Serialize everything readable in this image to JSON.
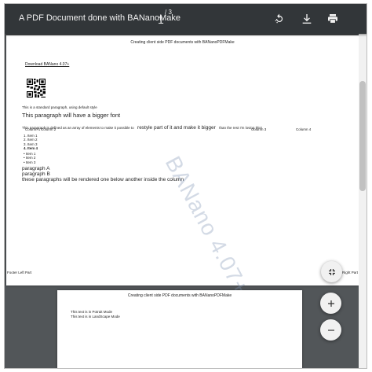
{
  "toolbar": {
    "title": "A PDF Document done with BANanoMake",
    "page_current": "1",
    "page_separator": "/ 3"
  },
  "page1": {
    "header": "Creating client side PDF documents with BANanoPDFMake",
    "link": "Download BANano 4.07+",
    "standard_paragraph": "This is a standard paragraph, using default style",
    "bigger_font": "This paragraph will have a bigger font",
    "array_text_start": "This paragraph is defined as an array of elements to make it possible to",
    "array_text_restyle": "restyle part of it and make it bigger",
    "array_text_end": "than the rest I'm loving this!",
    "columns": [
      "Column 1",
      "Column 2",
      "Column 3",
      "Column 4"
    ],
    "ordered_list": [
      "1. Item 1",
      "2. Item 2",
      "3. Item 3",
      "4. Item 4"
    ],
    "bullet_list": [
      "• Item 1",
      "• Item 2",
      "• Item 3"
    ],
    "paragraph_a": "paragraph A",
    "paragraph_b": "paragraph B",
    "below_text": "these paragraphs will be rendered one below another inside the column",
    "watermark": "BANano 4.07+",
    "footer_left": "Footer Left Part",
    "footer_right": "er Right Part"
  },
  "page2": {
    "header": "Creating client side PDF documents with BANanoPDFMake",
    "portrait": "This text is in Potrait Mode",
    "landscape": "This text is in LandScape Mode"
  },
  "icons": {
    "rotate": "rotate-icon",
    "download": "download-icon",
    "print": "print-icon",
    "fit": "fit-page-icon",
    "zoom_in": "zoom-in-icon",
    "zoom_out": "zoom-out-icon"
  }
}
